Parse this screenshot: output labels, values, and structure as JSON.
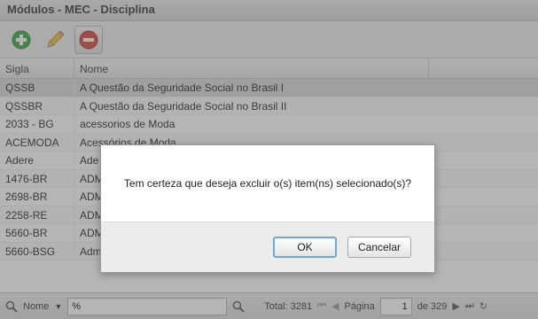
{
  "window": {
    "title": "Módulos - MEC - Disciplina"
  },
  "toolbar": {
    "add_icon": "add-icon",
    "edit_icon": "edit-icon",
    "delete_icon": "delete-icon"
  },
  "grid": {
    "headers": {
      "sigla": "Sigla",
      "nome": "Nome"
    },
    "rows": [
      {
        "sigla": "QSSB",
        "nome": "A Questão da Seguridade Social no Brasil I"
      },
      {
        "sigla": "QSSBR",
        "nome": "A Questão da Seguridade Social no Brasil II"
      },
      {
        "sigla": "2033 - BG",
        "nome": "acessorios de Moda"
      },
      {
        "sigla": "ACEMODA",
        "nome": "Acessórios de Moda"
      },
      {
        "sigla": "Adere",
        "nome": "Ade"
      },
      {
        "sigla": "1476-BR",
        "nome": "ADM"
      },
      {
        "sigla": "2698-BR",
        "nome": "ADM"
      },
      {
        "sigla": "2258-RE",
        "nome": "ADM"
      },
      {
        "sigla": "5660-BR",
        "nome": "ADM"
      },
      {
        "sigla": "5660-BSG",
        "nome": "Adm"
      }
    ]
  },
  "statusbar": {
    "search_field_label": "Nome",
    "search_value": "%",
    "total_label": "Total: 3281",
    "page_label": "Página",
    "page_value": "1",
    "page_of": "de 329"
  },
  "dialog": {
    "message": "Tem certeza que deseja excluir o(s) item(ns) selecionado(s)?",
    "ok_label": "OK",
    "cancel_label": "Cancelar"
  }
}
